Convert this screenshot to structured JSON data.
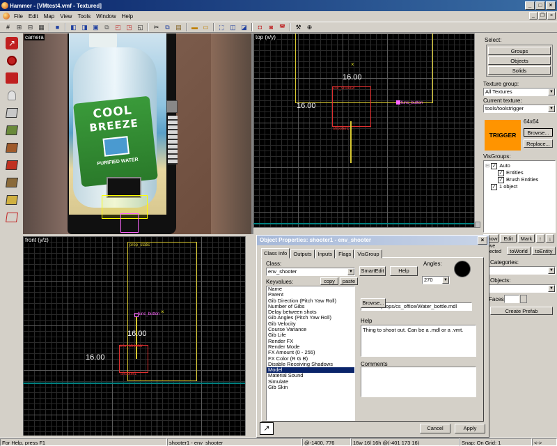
{
  "window": {
    "title": "Hammer - [VMtest4.vmf - Textured]",
    "min": "_",
    "max": "□",
    "close": "×"
  },
  "menu": {
    "items": [
      "File",
      "Edit",
      "Map",
      "View",
      "Tools",
      "Window",
      "Help"
    ]
  },
  "views": {
    "camera": {
      "label": "camera",
      "bottle_text_1": "COOL",
      "bottle_text_2": "BREEZE",
      "bottle_text_3": "PURIFIED WATER"
    },
    "top": {
      "label": "top (x/y)",
      "dim_1": "16.00",
      "dim_2": "16.00",
      "entity_1": "env_shooter",
      "entity_2": "func_button",
      "entity_3": "shooter1"
    },
    "front": {
      "label": "front (y/z)",
      "prop_label": "prop_static",
      "dim_1": "16.00",
      "dim_2": "16.00",
      "entity_1": "func_button",
      "entity_2": "env_shooter",
      "entity_3": "shooter1"
    }
  },
  "right_panel": {
    "select_label": "Select:",
    "buttons": [
      "Groups",
      "Objects",
      "Solids"
    ],
    "texture_group_label": "Texture group:",
    "texture_group_value": "All Textures",
    "current_texture_label": "Current texture:",
    "current_texture_value": "tools/toolstrigger",
    "texture_preview": "TRIGGER",
    "texture_size": "64x64",
    "browse": "Browse...",
    "replace": "Replace...",
    "visgroups_label": "VisGroups:",
    "visgroups": [
      {
        "label": "Auto",
        "checked": true
      },
      {
        "label": "Entities",
        "checked": true
      },
      {
        "label": "Brush Entities",
        "checked": true
      },
      {
        "label": "1 object",
        "checked": true
      }
    ],
    "vis_buttons": [
      "Show",
      "Edit",
      "Mark",
      "↑",
      "↓"
    ],
    "move_selected": "Move\nselected",
    "to_world": "toWorld",
    "to_entity": "toEntity",
    "categories_label": "Categories:",
    "objects_label": "Objects:",
    "faces_label": "Faces:",
    "create_prefab": "Create Prefab"
  },
  "dialog": {
    "title": "Object Properties: shooter1 - env_shooter",
    "tabs": [
      "Class Info",
      "Outputs",
      "Inputs",
      "Flags",
      "VisGroup"
    ],
    "class_label": "Class:",
    "class_value": "env_shooter",
    "smartedit": "SmartEdit",
    "help_btn": "Help",
    "angles_label": "Angles:",
    "angles_value": "270",
    "keyvalues_label": "Keyvalues:",
    "copy": "copy",
    "paste": "paste",
    "keys": [
      "Name",
      "Parent",
      "Gib Direction (Pitch Yaw Roll)",
      "Number of Gibs",
      "Delay between shots",
      "Gib Angles (Pitch Yaw Roll)",
      "Gib Velocity",
      "Course Variance",
      "Gib Life",
      "Render FX",
      "Render Mode",
      "FX Amount (0 - 255)",
      "FX Color (R G B)",
      "Disable Receiving Shadows",
      "Model",
      "Material Sound",
      "Simulate",
      "Gib Skin"
    ],
    "selected_key": "Model",
    "model_value": "models/props/cs_office/Water_bottle.mdl",
    "browse": "Browse...",
    "help_label": "Help",
    "help_text": "Thing to shoot out.  Can be a .mdl or a .vmt.",
    "comments_label": "Comments",
    "cancel": "Cancel",
    "apply": "Apply"
  },
  "status": {
    "help": "For Help, press F1",
    "selection": "shooter1 - env_shooter",
    "coords": "@-1400, 776",
    "size": "16w 16l 16h @(-401 173 16)",
    "snap": "Snap: On Grid: 1",
    "zoom": "<->"
  }
}
